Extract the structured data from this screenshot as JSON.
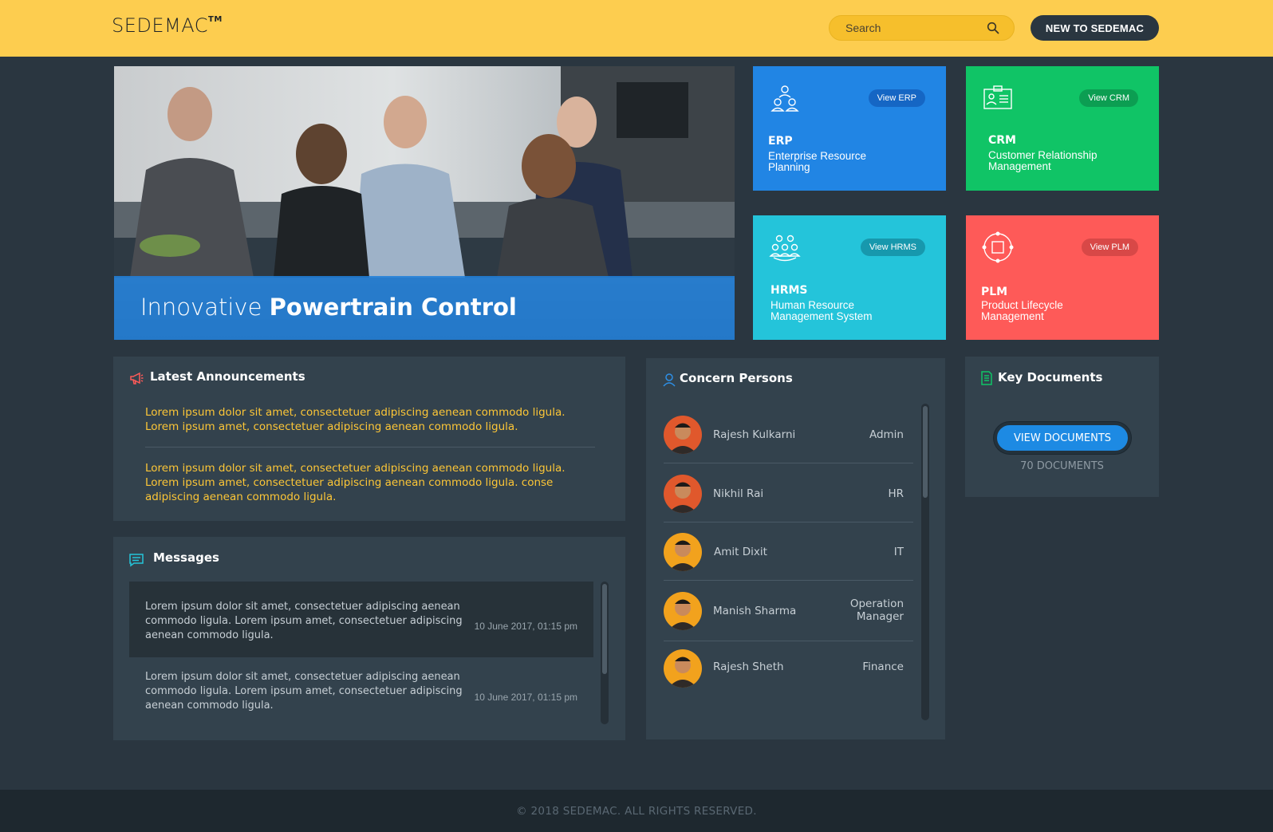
{
  "header": {
    "logo": "SEDEMAC",
    "logo_mark": "TM",
    "search_placeholder": "Search",
    "cta_label": "NEW TO SEDEMAC"
  },
  "hero": {
    "title_light": "Innovative",
    "title_bold": "Powertrain Control"
  },
  "tiles": [
    {
      "code": "ERP",
      "description": "Enterprise Resource Planning",
      "button": "View ERP",
      "color": "#2185e4",
      "icon": "users-icon"
    },
    {
      "code": "CRM",
      "description": "Customer Relationship Management",
      "button": "View CRM",
      "color": "#10c466",
      "icon": "id-card-icon"
    },
    {
      "code": "HRMS",
      "description": "Human Resource Management System",
      "button": "View HRMS",
      "color": "#24c4da",
      "icon": "team-icon"
    },
    {
      "code": "PLM",
      "description": "Product Lifecycle Management",
      "button": "View PLM",
      "color": "#fe5a58",
      "icon": "cycle-icon"
    }
  ],
  "announcements": {
    "title": "Latest Announcements",
    "items": [
      "Lorem ipsum dolor sit amet, consectetuer adipiscing aenean commodo ligula. Lorem ipsum amet, consectetuer adipiscing aenean commodo ligula.",
      "Lorem ipsum dolor sit amet, consectetuer adipiscing aenean commodo ligula. Lorem ipsum amet, consectetuer adipiscing aenean commodo ligula. conse adipiscing aenean commodo ligula."
    ]
  },
  "messages": {
    "title": "Messages",
    "items": [
      {
        "text": "Lorem ipsum dolor sit amet, consectetuer adipiscing aenean commodo ligula. Lorem ipsum amet, consectetuer adipiscing aenean commodo ligula.",
        "date": "10 June 2017, 01:15 pm"
      },
      {
        "text": "Lorem ipsum dolor sit amet, consectetuer adipiscing aenean commodo ligula. Lorem ipsum amet, consectetuer adipiscing aenean commodo ligula.",
        "date": "10 June 2017, 01:15 pm"
      }
    ]
  },
  "persons": {
    "title": "Concern Persons",
    "items": [
      {
        "name": "Rajesh Kulkarni",
        "role": "Admin"
      },
      {
        "name": "Nikhil Rai",
        "role": "HR"
      },
      {
        "name": "Amit Dixit",
        "role": "IT"
      },
      {
        "name": "Manish Sharma",
        "role": "Operation Manager"
      },
      {
        "name": "Rajesh Sheth",
        "role": "Finance"
      }
    ]
  },
  "documents": {
    "title": "Key Documents",
    "button": "VIEW DOCUMENTS",
    "count": "70 DOCUMENTS"
  },
  "footer": {
    "text": "© 2018 SEDEMAC. ALL RIGHTS RESERVED."
  }
}
